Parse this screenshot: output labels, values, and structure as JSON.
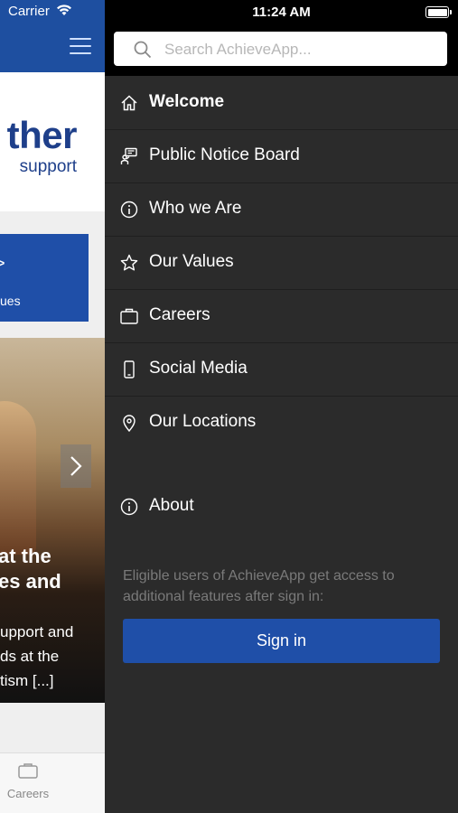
{
  "status_bar": {
    "carrier": "Carrier",
    "time": "11:24 AM"
  },
  "background_app": {
    "hero_big": "ther",
    "hero_small": "support",
    "tile_chevron": ">",
    "tile_text": "ues",
    "headline": "at the\nes and",
    "body": "upport and\nds at the\ntism [...]",
    "tab_careers_label": "Careers"
  },
  "search": {
    "placeholder": "Search AchieveApp..."
  },
  "menu": {
    "items": [
      {
        "label": "Welcome",
        "icon": "home-icon"
      },
      {
        "label": "Public Notice Board",
        "icon": "notice-board-icon"
      },
      {
        "label": "Who we Are",
        "icon": "info-icon"
      },
      {
        "label": "Our Values",
        "icon": "star-icon"
      },
      {
        "label": "Careers",
        "icon": "briefcase-icon"
      },
      {
        "label": "Social Media",
        "icon": "phone-icon"
      },
      {
        "label": "Our Locations",
        "icon": "location-pin-icon"
      }
    ],
    "about_label": "About"
  },
  "signin": {
    "info": "Eligible users of AchieveApp get access to additional features after sign in:",
    "button_label": "Sign in"
  },
  "colors": {
    "brand_blue": "#1f4fa8",
    "drawer_bg": "#2b2b2b",
    "header_blue": "#1e4fa0"
  }
}
